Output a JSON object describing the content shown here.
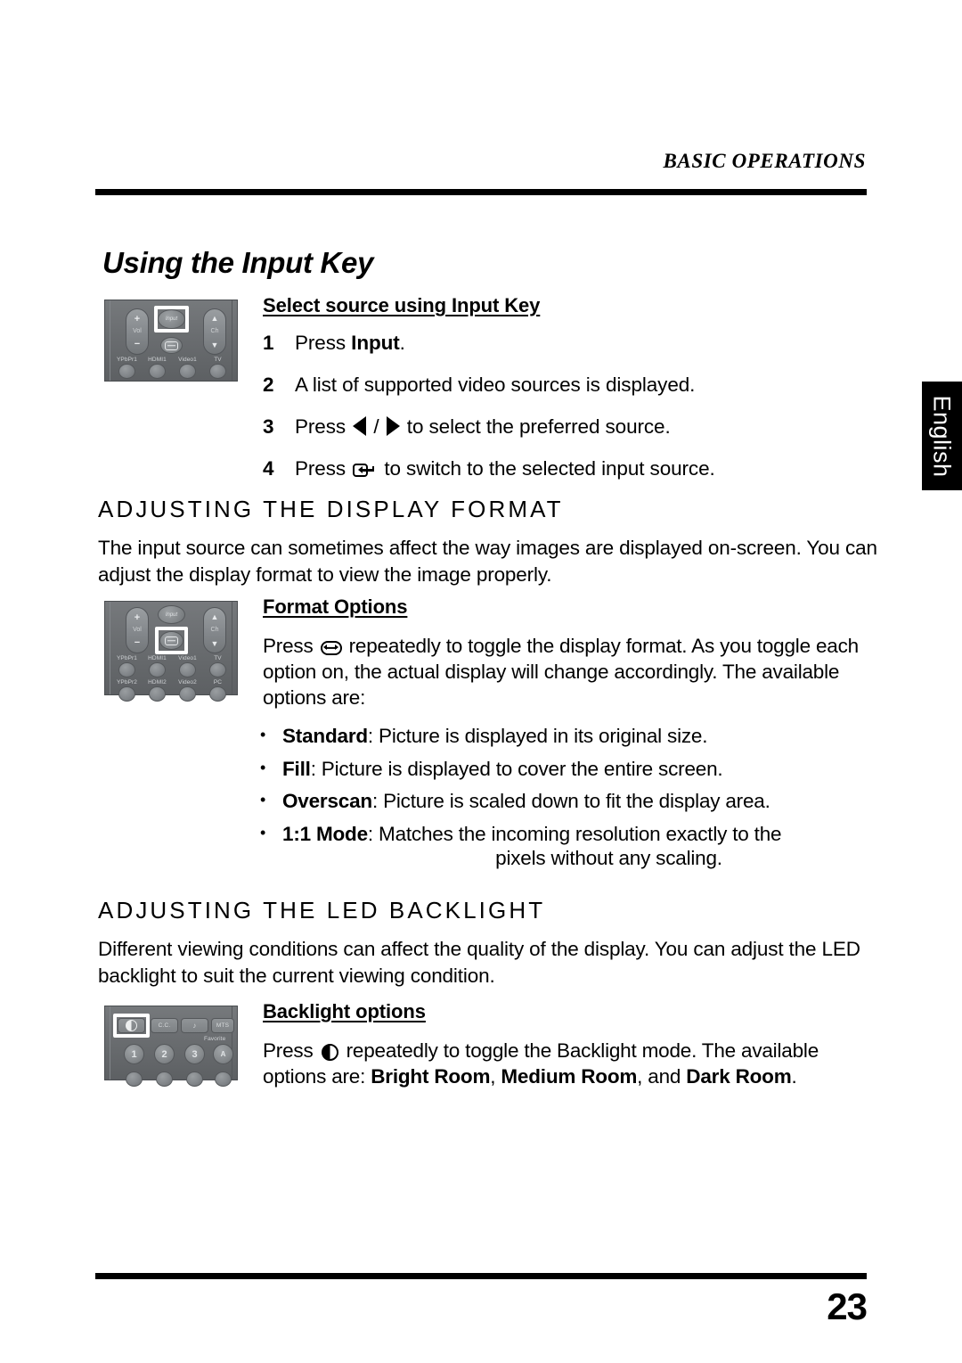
{
  "header": {
    "running_head": "BASIC OPERATIONS",
    "language_tab": "English",
    "page_number": "23"
  },
  "title": "Using the Input Key",
  "sections": {
    "input_key": {
      "subhead": "Select source using Input Key",
      "steps": [
        {
          "num": "1",
          "pre": "Press ",
          "bold": "Input",
          "post": "."
        },
        {
          "num": "2",
          "text": "A list of supported video sources is displayed."
        },
        {
          "num": "3",
          "pre": "Press ",
          "icon": "left-right-arrow-keys",
          "post": " to select the preferred source."
        },
        {
          "num": "4",
          "pre": "Press ",
          "icon": "enter-key",
          "post": " to switch to the selected input source."
        }
      ]
    },
    "display_format": {
      "heading": "ADJUSTING THE DISPLAY FORMAT",
      "intro": "The input source can sometimes affect the way images are displayed on-screen. You can adjust the display format to view the image properly.",
      "subhead": "Format Options",
      "paragraph_pre": "Press ",
      "paragraph_icon": "format-key",
      "paragraph_post": " repeatedly to toggle the display format. As you toggle each option on, the actual display will change accordingly. The available options are:",
      "options": [
        {
          "term": "Standard",
          "desc": ": Picture is displayed in its original size."
        },
        {
          "term": "Fill",
          "desc": ": Picture is displayed to cover the entire screen."
        },
        {
          "term": "Overscan",
          "desc": ": Picture is scaled down to fit the display area."
        },
        {
          "term": "1:1 Mode",
          "desc": ": Matches the incoming resolution exactly to the",
          "desc2": "pixels without any scaling."
        }
      ]
    },
    "led_backlight": {
      "heading": "ADJUSTING THE LED BACKLIGHT",
      "intro": "Different viewing conditions can affect the quality of the display. You can adjust the LED backlight to suit the current viewing condition.",
      "subhead": "Backlight options",
      "paragraph_pre": "Press ",
      "paragraph_icon": "backlight-key",
      "paragraph_mid": " repeatedly to toggle the Backlight mode. The available options are: ",
      "opt1": "Bright Room",
      "sep1": ", ",
      "opt2": "Medium Room",
      "sep2": ", and ",
      "opt3": "Dark Room",
      "end": "."
    }
  },
  "remote_input": {
    "vol_plus": "+",
    "vol_label": "Vol",
    "vol_minus": "−",
    "input_button": "Input",
    "ch_up": "▲",
    "ch_label": "Ch",
    "ch_down": "▼",
    "source_labels": [
      "YPbPr1",
      "HDMI1",
      "Video1",
      "TV"
    ]
  },
  "remote_format": {
    "vol_plus": "+",
    "vol_label": "Vol",
    "vol_minus": "−",
    "input_button": "Input",
    "ch_up": "▲",
    "ch_label": "Ch",
    "ch_down": "▼",
    "source_labels_row1": [
      "YPbPr1",
      "HDMI1",
      "Video1",
      "TV"
    ],
    "source_labels_row2": [
      "YPbPr2",
      "HDMI2",
      "Video2",
      "PC"
    ]
  },
  "remote_backlight": {
    "buttons": [
      "C.C.",
      "♪",
      "MTS"
    ],
    "favorite_label": "Favorite",
    "numbers": [
      "1",
      "2",
      "3"
    ],
    "favorite_key": "A"
  },
  "colors": {
    "rule": "#000000",
    "tab_background": "#000000",
    "tab_text": "#ffffff",
    "remote_body": "#6a6d70",
    "highlight": "#ffffff"
  }
}
